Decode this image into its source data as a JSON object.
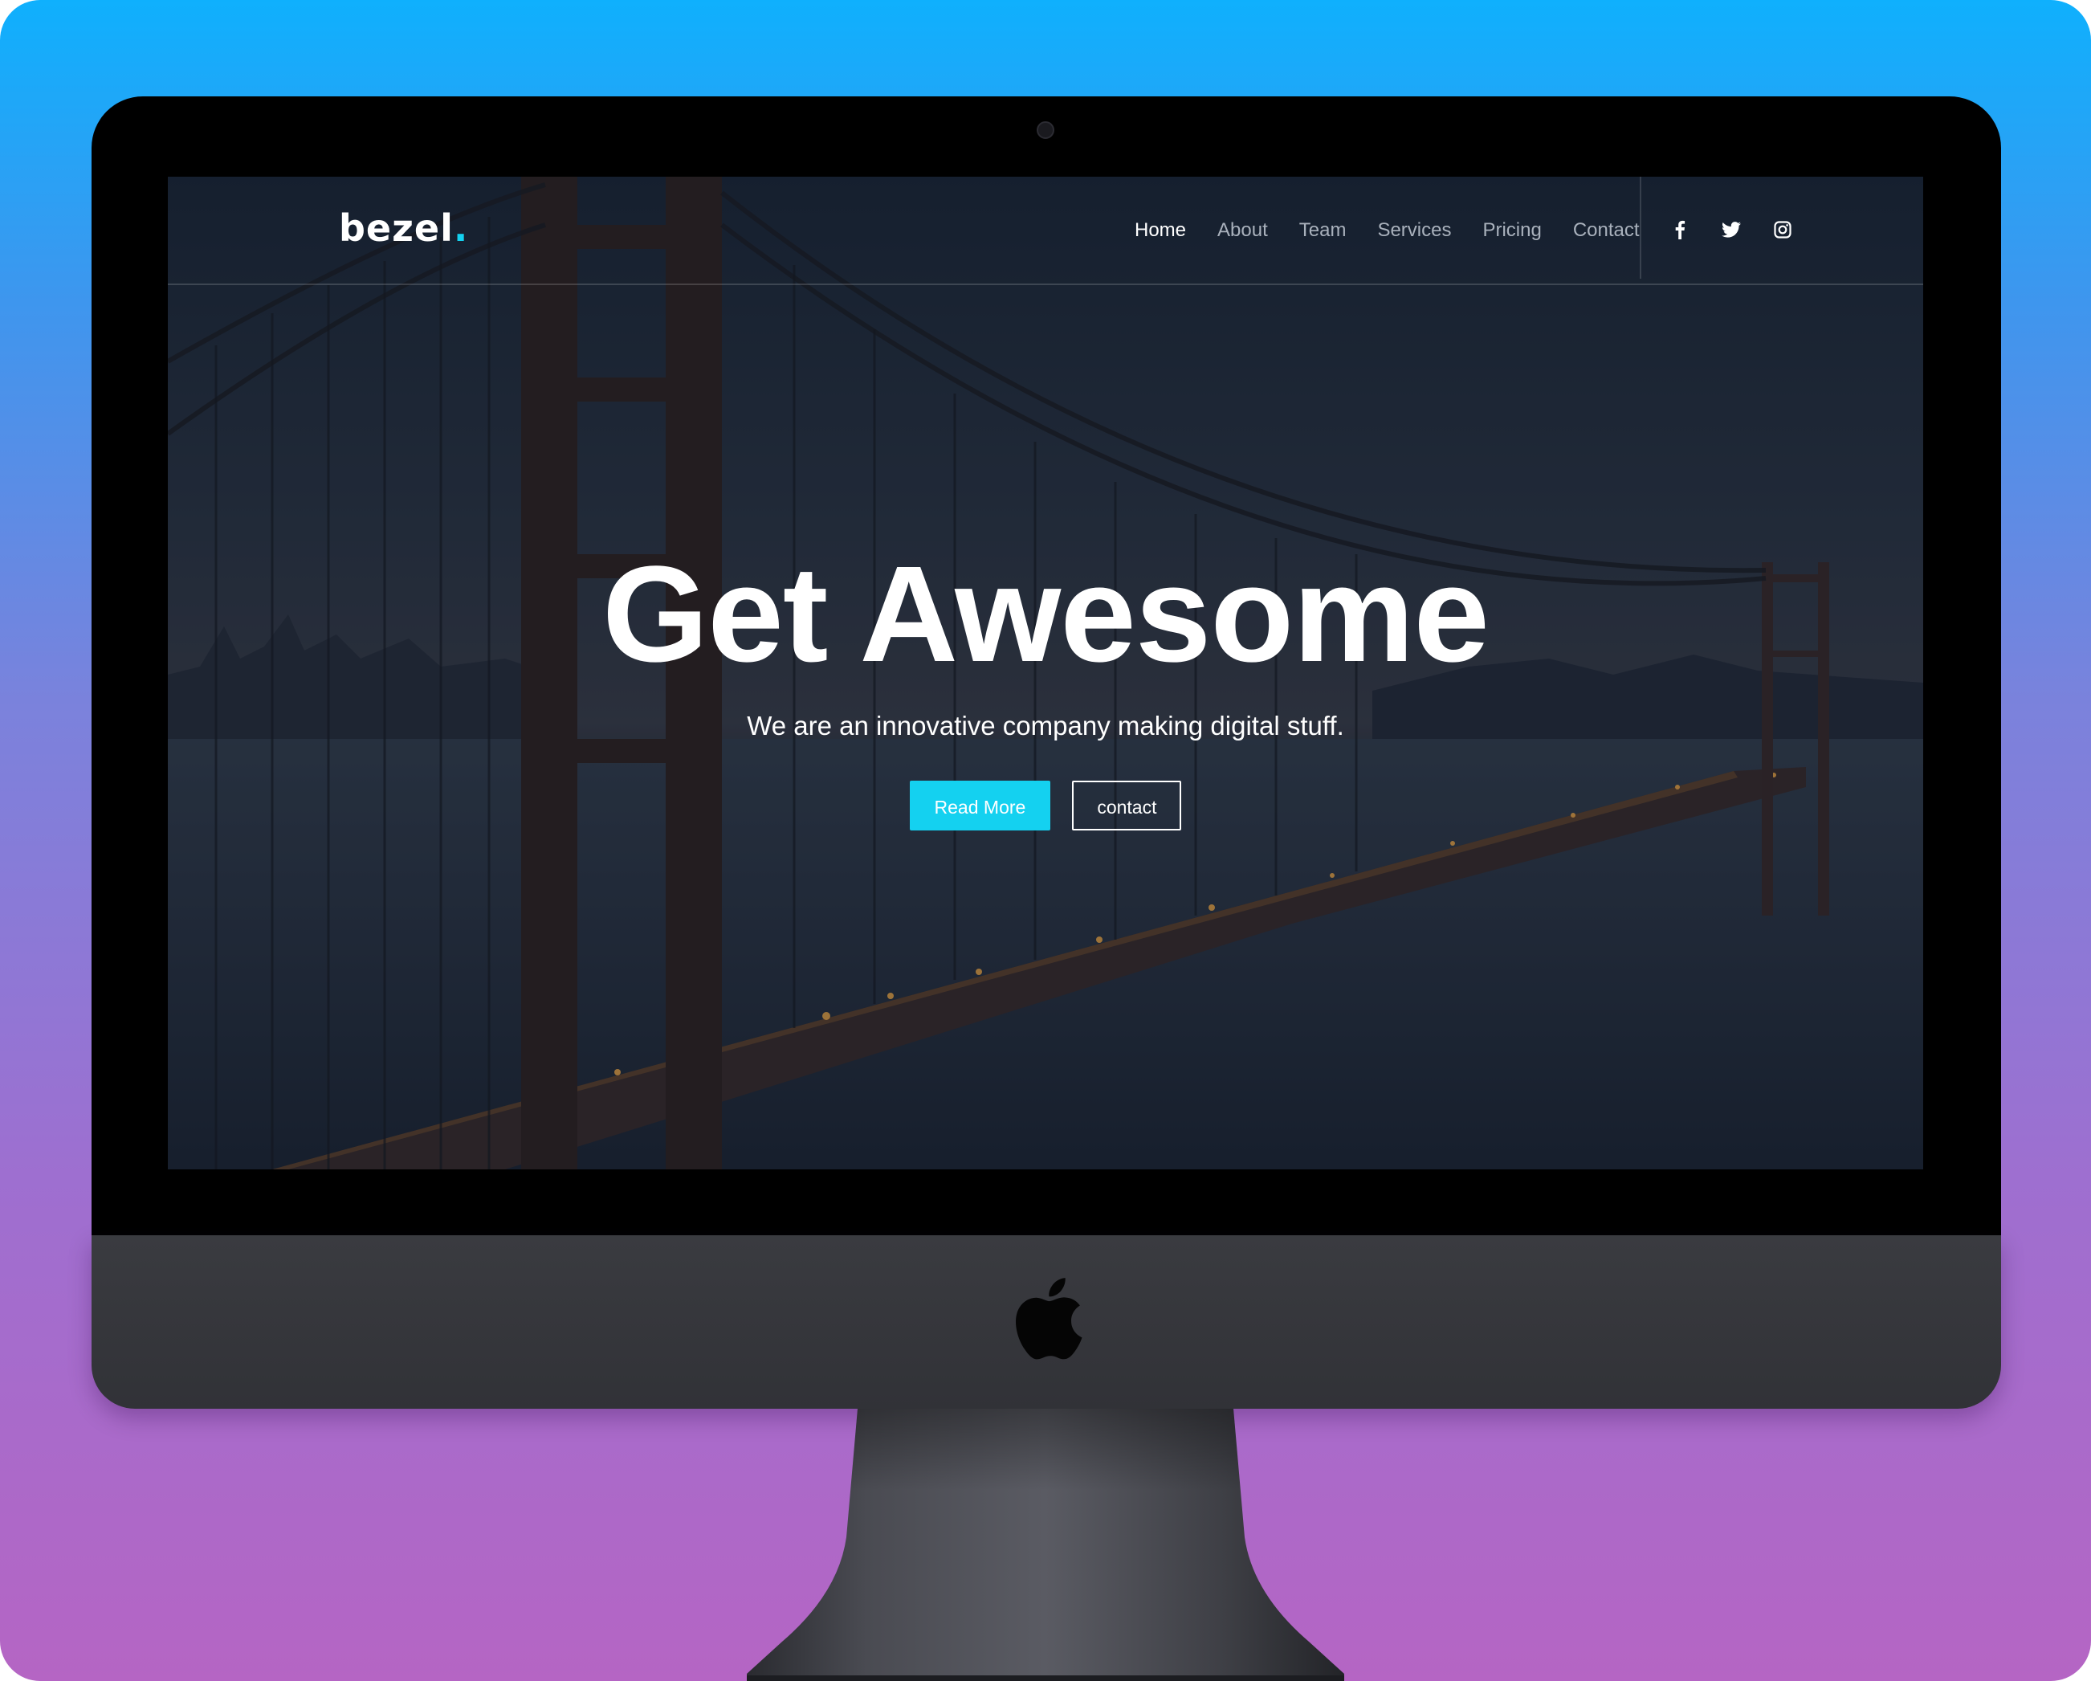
{
  "brand": {
    "name": "bezel",
    "dot": ".",
    "accent_color": "#14d1f0"
  },
  "nav": {
    "items": [
      {
        "label": "Home",
        "active": true
      },
      {
        "label": "About",
        "active": false
      },
      {
        "label": "Team",
        "active": false
      },
      {
        "label": "Services",
        "active": false
      },
      {
        "label": "Pricing",
        "active": false
      },
      {
        "label": "Contact",
        "active": false
      }
    ],
    "social": [
      {
        "icon": "facebook-icon"
      },
      {
        "icon": "twitter-icon"
      },
      {
        "icon": "instagram-icon"
      }
    ]
  },
  "hero": {
    "title": "Get Awesome",
    "subtitle": "We are an innovative company making digital stuff.",
    "primary_button": "Read More",
    "secondary_button": "contact",
    "primary_color": "#14d1f0"
  },
  "device": {
    "type": "iMac",
    "logo": "apple-logo"
  }
}
